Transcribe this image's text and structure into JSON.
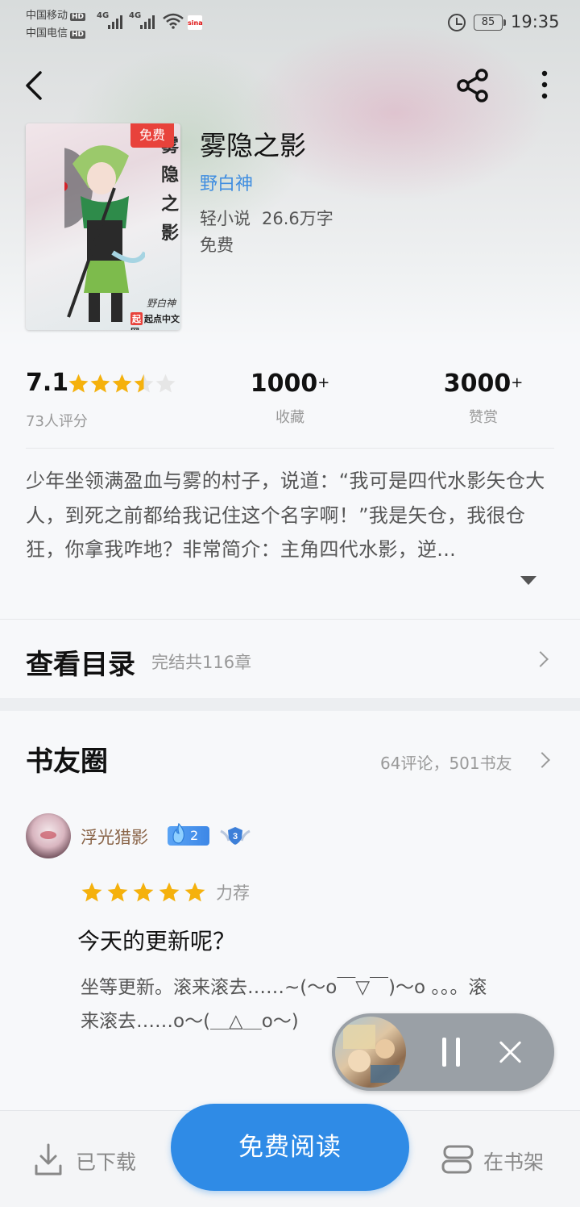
{
  "status_bar": {
    "carrier1": "中国移动",
    "carrier2": "中国电信",
    "hd": "HD",
    "net1": "4G",
    "net2": "4G",
    "sina": "sina",
    "battery": "85",
    "time": "19:35"
  },
  "nav": {
    "icons": [
      "back-icon",
      "share-icon",
      "more-icon"
    ]
  },
  "book": {
    "title": "雾隐之影",
    "author": "野白神",
    "category": "轻小说",
    "word_count": "26.6万字",
    "price": "免费",
    "cover_tag": "免费",
    "cover_calligraphy": "雾隐之影",
    "cover_signature": "野白神",
    "cover_logo_mark": "起",
    "cover_logo_text": "起点中文网"
  },
  "stats": {
    "rating": "7.1",
    "rating_stars": 3.5,
    "rating_count": "73人评分",
    "favorites_value": "1000",
    "favorites_plus": "+",
    "favorites_label": "收藏",
    "rewards_value": "3000",
    "rewards_plus": "+",
    "rewards_label": "赞赏"
  },
  "description": "少年坐领满盈血与雾的村子，说道：“我可是四代水影矢仓大人，到死之前都给我记住这个名字啊！”我是矢仓，我很仓狂，你拿我咋地？非常简介：主角四代水影，逆...",
  "toc": {
    "title": "查看目录",
    "subtitle": "完结共116章"
  },
  "circle": {
    "title": "书友圈",
    "meta": "64评论，501书友"
  },
  "review": {
    "username": "浮光猎影",
    "fire_level": "2",
    "fan_level": "3",
    "stars": 5,
    "tag": "力荐",
    "title": "今天的更新呢？",
    "body": "坐等更新。滚来滚去……~(～o￣▽￣)～o 。。。滚来滚去……o～(＿△＿o～)"
  },
  "player": {
    "controls": [
      "pause-icon",
      "close-icon"
    ]
  },
  "bottom_bar": {
    "downloaded": "已下载",
    "read_button": "免费阅读",
    "on_shelf": "在书架"
  },
  "colors": {
    "accent_blue": "#2f8be6",
    "author_blue": "#3f8de0",
    "star_yellow": "#f5b10c",
    "tag_red": "#e8423b"
  }
}
